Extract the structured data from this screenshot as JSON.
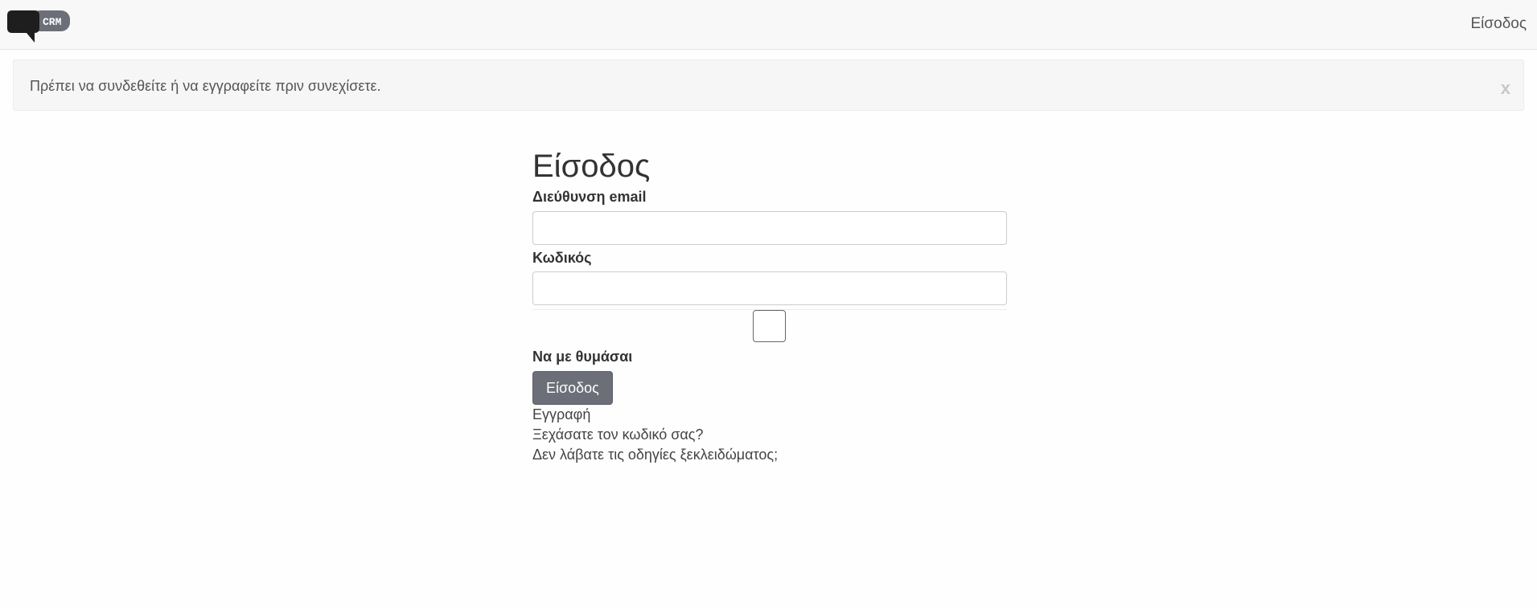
{
  "navbar": {
    "logo_text": "CRM",
    "login_link": "Είσοδος"
  },
  "alert": {
    "message": "Πρέπει να συνδεθείτε ή να εγγραφείτε πριν συνεχίσετε.",
    "close_label": "x"
  },
  "form": {
    "title": "Είσοδος",
    "email_label": "Διεύθυνση email",
    "email_value": "",
    "password_label": "Κωδικός",
    "password_value": "",
    "remember_label": "Να με θυμάσαι",
    "remember_checked": false,
    "submit_label": "Είσοδος"
  },
  "links": {
    "register": "Εγγραφή",
    "forgot_password": "Ξεχάσατε τον κωδικό σας?",
    "no_unlock_instructions": "Δεν λάβατε τις οδηγίες ξεκλειδώματος;"
  },
  "colors": {
    "navbar_bg": "#f9f8f8",
    "button_bg": "#6c6f78",
    "logo_badge": "#6c6f78",
    "logo_bubble": "#1e1e1e"
  }
}
